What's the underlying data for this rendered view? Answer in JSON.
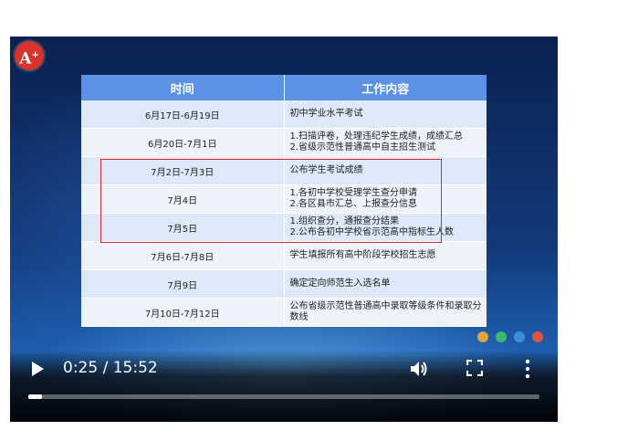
{
  "logo": {
    "text": "A",
    "sup": "+"
  },
  "table": {
    "headers": [
      "时间",
      "工作内容"
    ],
    "rows": [
      {
        "time": "6月17日-6月19日",
        "lines": [
          "初中学业水平考试"
        ]
      },
      {
        "time": "6月20日-7月1日",
        "lines": [
          "1.扫描评卷，处理违纪学生成绩，成绩汇总",
          "2.省级示范性普通高中自主招生测试"
        ]
      },
      {
        "time": "7月2日-7月3日",
        "lines": [
          "公布学生考试成绩"
        ]
      },
      {
        "time": "7月4日",
        "lines": [
          "1.各初中学校受理学生查分申请",
          "2.各区县市汇总、上报查分信息"
        ]
      },
      {
        "time": "7月5日",
        "lines": [
          "1.组织查分，通报查分结果",
          "2.公布各初中学校省示范高中指标生人数"
        ]
      },
      {
        "time": "7月6日-7月8日",
        "lines": [
          "学生填报所有高中阶段学校招生志愿"
        ]
      },
      {
        "time": "7月9日",
        "lines": [
          "确定定向师范生入选名单"
        ]
      },
      {
        "time": "7月10日-7月12日",
        "lines": [
          "公布省级示范性普通高中录取等级条件和录取分数线"
        ]
      }
    ]
  },
  "decor_dots": [
    "#e2a33a",
    "#3dba6e",
    "#3b8fd9",
    "#e0533f"
  ],
  "player": {
    "time_display": "0:25 / 15:52",
    "progress_fraction": 0.027,
    "play_icon": "play-icon",
    "volume_icon": "volume-icon",
    "fullscreen_icon": "fullscreen-icon",
    "more_icon": "more-vertical-icon"
  }
}
